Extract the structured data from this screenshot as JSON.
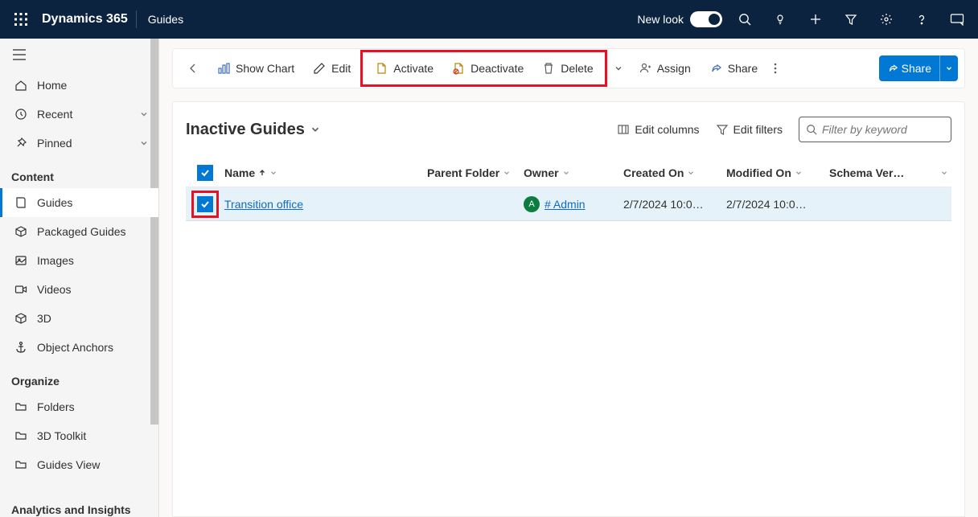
{
  "topbar": {
    "brand": "Dynamics 365",
    "app": "Guides",
    "newlook": "New look"
  },
  "sidebar": {
    "home": "Home",
    "recent": "Recent",
    "pinned": "Pinned",
    "sections": {
      "content": "Content",
      "organize": "Organize",
      "analytics": "Analytics and Insights"
    },
    "content_items": {
      "guides": "Guides",
      "packaged": "Packaged Guides",
      "images": "Images",
      "videos": "Videos",
      "threed": "3D",
      "anchors": "Object Anchors"
    },
    "organize_items": {
      "folders": "Folders",
      "toolkit": "3D Toolkit",
      "guidesview": "Guides View"
    }
  },
  "cmdbar": {
    "showchart": "Show Chart",
    "edit": "Edit",
    "activate": "Activate",
    "deactivate": "Deactivate",
    "delete": "Delete",
    "assign": "Assign",
    "share": "Share",
    "share_primary": "Share"
  },
  "view": {
    "title": "Inactive Guides",
    "editcols": "Edit columns",
    "editfilters": "Edit filters",
    "search_placeholder": "Filter by keyword"
  },
  "grid": {
    "cols": {
      "name": "Name",
      "parent": "Parent Folder",
      "owner": "Owner",
      "created": "Created On",
      "modified": "Modified On",
      "schema": "Schema Ver…"
    },
    "rows": [
      {
        "name": "Transition office",
        "parent": "",
        "owner": "# Admin",
        "owner_initial": "A",
        "created": "2/7/2024 10:0…",
        "modified": "2/7/2024 10:0…",
        "schema": ""
      }
    ]
  }
}
